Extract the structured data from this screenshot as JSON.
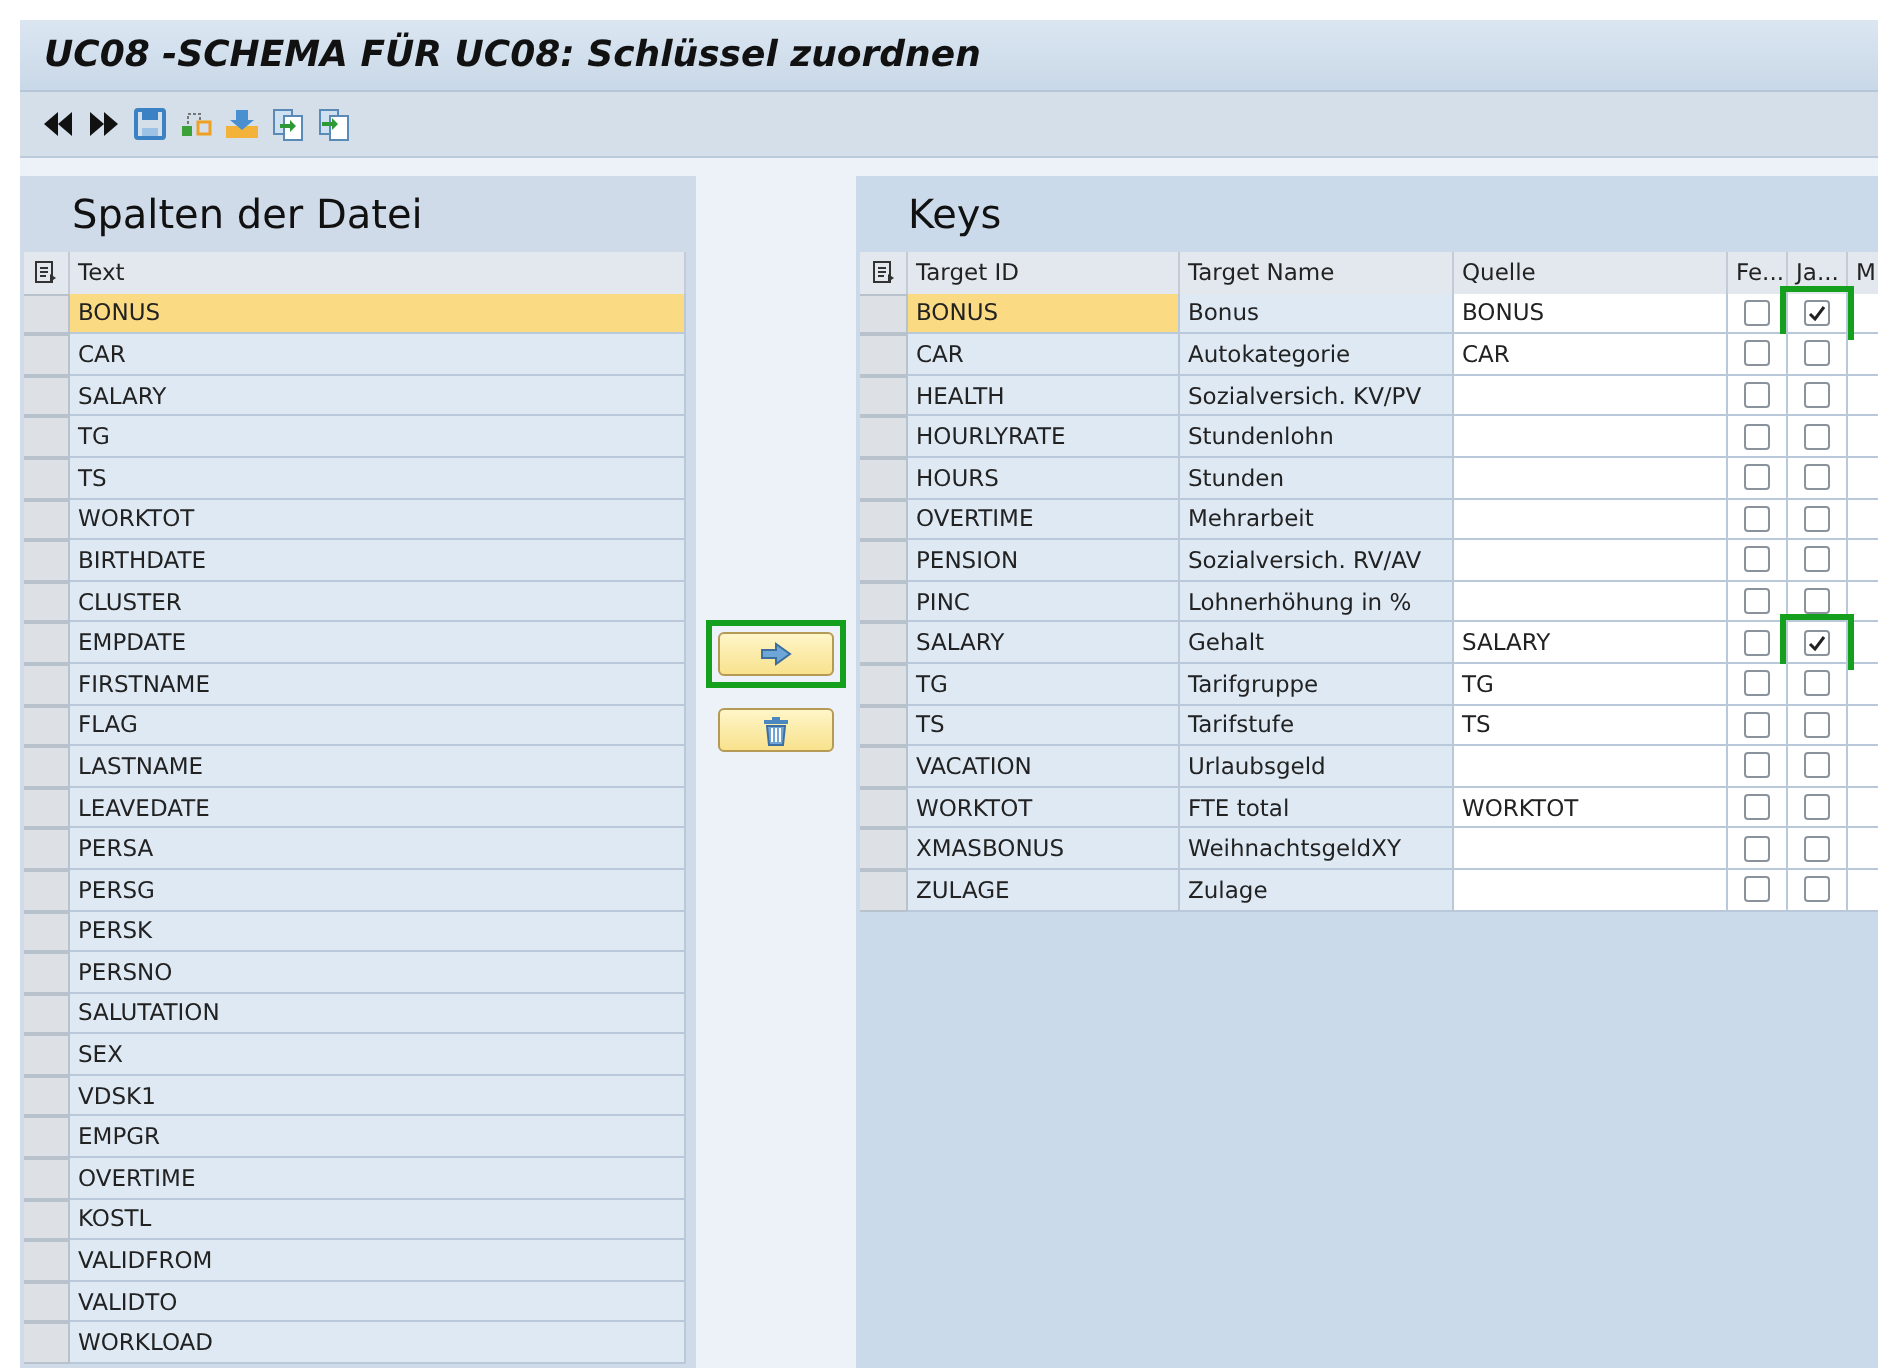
{
  "window": {
    "title": "UC08 -SCHEMA FÜR UC08: Schlüssel zuordnen"
  },
  "toolbar": [
    {
      "kind": "rewind"
    },
    {
      "kind": "forward"
    },
    {
      "kind": "save"
    },
    {
      "kind": "nodes"
    },
    {
      "kind": "import"
    },
    {
      "kind": "copy-in"
    },
    {
      "kind": "copy-out"
    }
  ],
  "left_panel": {
    "title": "Spalten der Datei",
    "column": "Text",
    "rows": [
      {
        "text": "BONUS",
        "selected": true
      },
      {
        "text": "CAR",
        "selected": false
      },
      {
        "text": "SALARY",
        "selected": false
      },
      {
        "text": "TG",
        "selected": false
      },
      {
        "text": "TS",
        "selected": false
      },
      {
        "text": "WORKTOT",
        "selected": false
      },
      {
        "text": "BIRTHDATE",
        "selected": false
      },
      {
        "text": "CLUSTER",
        "selected": false
      },
      {
        "text": "EMPDATE",
        "selected": false
      },
      {
        "text": "FIRSTNAME",
        "selected": false
      },
      {
        "text": "FLAG",
        "selected": false
      },
      {
        "text": "LASTNAME",
        "selected": false
      },
      {
        "text": "LEAVEDATE",
        "selected": false
      },
      {
        "text": "PERSA",
        "selected": false
      },
      {
        "text": "PERSG",
        "selected": false
      },
      {
        "text": "PERSK",
        "selected": false
      },
      {
        "text": "PERSNO",
        "selected": false
      },
      {
        "text": "SALUTATION",
        "selected": false
      },
      {
        "text": "SEX",
        "selected": false
      },
      {
        "text": "VDSK1",
        "selected": false
      },
      {
        "text": "EMPGR",
        "selected": false
      },
      {
        "text": "OVERTIME",
        "selected": false
      },
      {
        "text": "KOSTL",
        "selected": false
      },
      {
        "text": "VALIDFROM",
        "selected": false
      },
      {
        "text": "VALIDTO",
        "selected": false
      },
      {
        "text": "WORKLOAD",
        "selected": false
      }
    ]
  },
  "actions": [
    {
      "kind": "assign",
      "highlighted": true
    },
    {
      "kind": "delete",
      "highlighted": false
    }
  ],
  "right_panel": {
    "title": "Keys",
    "columns": [
      "Target ID",
      "Target Name",
      "Quelle",
      "Fe...",
      "Ja...",
      "M"
    ],
    "rows": [
      {
        "target_id": "BONUS",
        "target_name": "Bonus",
        "quelle": "BONUS",
        "fe": false,
        "ja": true,
        "ja_highlighted": true,
        "selected": true
      },
      {
        "target_id": "CAR",
        "target_name": "Autokategorie",
        "quelle": "CAR",
        "fe": false,
        "ja": false,
        "ja_highlighted": false,
        "selected": false
      },
      {
        "target_id": "HEALTH",
        "target_name": "Sozialversich. KV/PV",
        "fe": false,
        "ja": false,
        "ja_highlighted": false,
        "selected": false
      },
      {
        "target_id": "HOURLYRATE",
        "target_name": "Stundenlohn",
        "fe": false,
        "ja": false,
        "ja_highlighted": false,
        "selected": false
      },
      {
        "target_id": "HOURS",
        "target_name": "Stunden",
        "fe": false,
        "ja": false,
        "ja_highlighted": false,
        "selected": false
      },
      {
        "target_id": "OVERTIME",
        "target_name": "Mehrarbeit",
        "fe": false,
        "ja": false,
        "ja_highlighted": false,
        "selected": false
      },
      {
        "target_id": "PENSION",
        "target_name": "Sozialversich. RV/AV",
        "fe": false,
        "ja": false,
        "ja_highlighted": false,
        "selected": false
      },
      {
        "target_id": "PINC",
        "target_name": "Lohnerhöhung in %",
        "fe": false,
        "ja": false,
        "ja_highlighted": false,
        "selected": false
      },
      {
        "target_id": "SALARY",
        "target_name": "Gehalt",
        "quelle": "SALARY",
        "fe": false,
        "ja": true,
        "ja_highlighted": true,
        "selected": false
      },
      {
        "target_id": "TG",
        "target_name": "Tarifgruppe",
        "quelle": "TG",
        "fe": false,
        "ja": false,
        "ja_highlighted": false,
        "selected": false
      },
      {
        "target_id": "TS",
        "target_name": "Tarifstufe",
        "quelle": "TS",
        "fe": false,
        "ja": false,
        "ja_highlighted": false,
        "selected": false
      },
      {
        "target_id": "VACATION",
        "target_name": "Urlaubsgeld",
        "fe": false,
        "ja": false,
        "ja_highlighted": false,
        "selected": false
      },
      {
        "target_id": "WORKTOT",
        "target_name": "FTE total",
        "quelle": "WORKTOT",
        "fe": false,
        "ja": false,
        "ja_highlighted": false,
        "selected": false
      },
      {
        "target_id": "XMASBONUS",
        "target_name": "WeihnachtsgeldXY",
        "fe": false,
        "ja": false,
        "ja_highlighted": false,
        "selected": false
      },
      {
        "target_id": "ZULAGE",
        "target_name": "Zulage",
        "fe": false,
        "ja": false,
        "ja_highlighted": false,
        "selected": false
      }
    ]
  }
}
